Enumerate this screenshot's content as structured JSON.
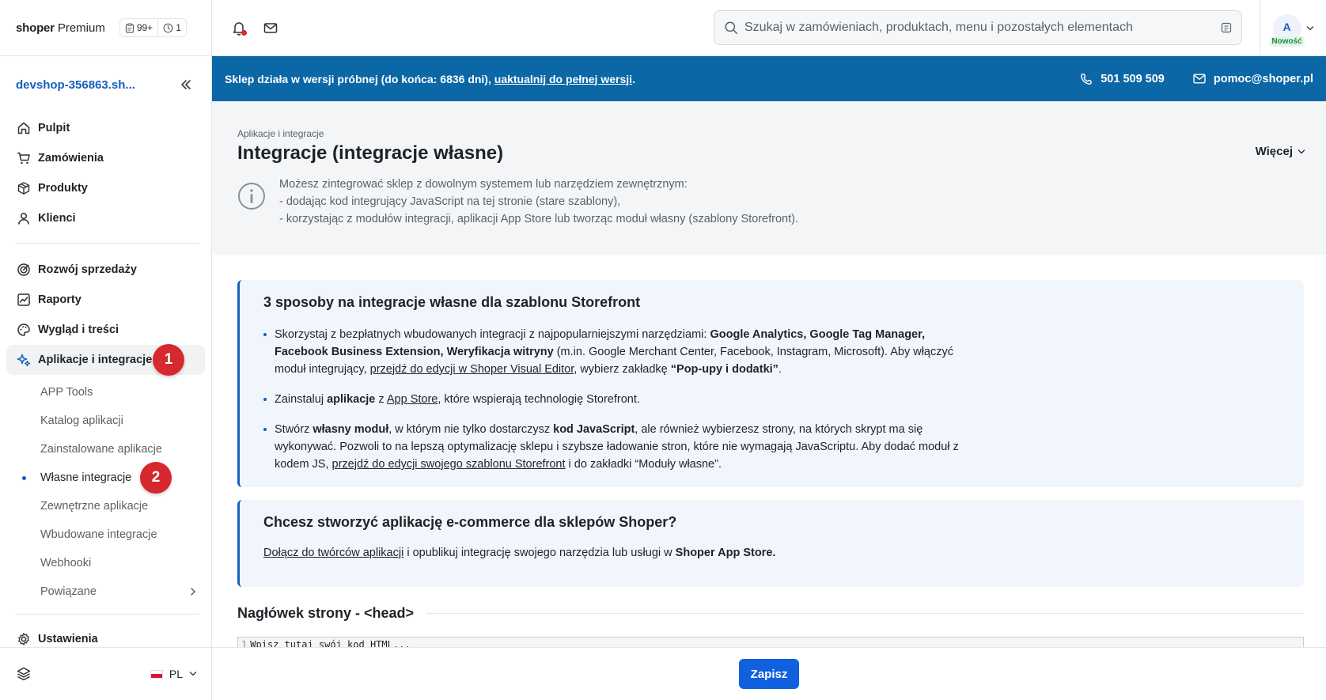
{
  "app": {
    "logo_brand": "shoper",
    "logo_plan": "Premium",
    "counter_tasks": "99+",
    "counter_history": "1"
  },
  "sidebar": {
    "shop_name": "devshop-356863.sh...",
    "main_items": [
      {
        "label": "Pulpit",
        "icon": "home-icon"
      },
      {
        "label": "Zamówienia",
        "icon": "cart-icon"
      },
      {
        "label": "Produkty",
        "icon": "box-icon"
      },
      {
        "label": "Klienci",
        "icon": "user-icon"
      }
    ],
    "secondary_items": [
      {
        "label": "Rozwój sprzedaży",
        "icon": "target-icon"
      },
      {
        "label": "Raporty",
        "icon": "chart-icon"
      },
      {
        "label": "Wygląd i treści",
        "icon": "palette-icon"
      },
      {
        "label": "Aplikacje i integracje",
        "icon": "sparkle-icon",
        "active": true
      }
    ],
    "sub_items": [
      {
        "label": "APP Tools"
      },
      {
        "label": "Katalog aplikacji"
      },
      {
        "label": "Zainstalowane aplikacje"
      },
      {
        "label": "Własne integracje",
        "active": true
      },
      {
        "label": "Zewnętrzne aplikacje"
      },
      {
        "label": "Wbudowane integracje"
      },
      {
        "label": "Webhooki"
      },
      {
        "label": "Powiązane"
      }
    ],
    "settings_label": "Ustawienia",
    "language": "PL",
    "annotation_1": "1",
    "annotation_2": "2"
  },
  "topbar": {
    "search_placeholder": "Szukaj w zamówieniach, produktach, menu i pozostałych elementach",
    "avatar_initial": "A",
    "avatar_badge": "Nowość"
  },
  "banner": {
    "text_prefix": "Sklep działa w wersji próbnej (do końca: 6836 dni), ",
    "upgrade_link": "uaktualnij do pełnej wersji",
    "text_suffix": ".",
    "phone": "501 509 509",
    "email": "pomoc@shoper.pl"
  },
  "header": {
    "breadcrumb": "Aplikacje i integracje",
    "title": "Integracje (integracje własne)",
    "more_label": "Więcej",
    "info_line1": "Możesz zintegrować sklep z dowolnym systemem lub narzędziem zewnętrznym:",
    "info_line2": "- dodając kod integrujący JavaScript na tej stronie (stare szablony),",
    "info_line3": "- korzystając z modułów integracji, aplikacji App Store lub tworząc moduł własny (szablony Storefront)."
  },
  "card1": {
    "title": "3 sposoby na integracje własne dla szablonu Storefront",
    "b1_t1": "Skorzystaj z bezpłatnych wbudowanych integracji z najpopularniejszymi narzędziami: ",
    "b1_bold": "Google Analytics, Google Tag Manager, Facebook Business Extension, Weryfikacja witryny",
    "b1_t2": " (m.in. Google Merchant Center, Facebook, Instagram, Microsoft). Aby włączyć moduł integrujący, ",
    "b1_link": "przejdź do edycji w Shoper Visual Editor",
    "b1_t3": ", wybierz zakładkę ",
    "b1_bold2": "“Pop-upy i dodatki”",
    "b1_t4": ".",
    "b2_t1": "Zainstaluj ",
    "b2_bold": "aplikacje",
    "b2_t2": " z ",
    "b2_link": "App Store",
    "b2_t3": ", które wspierają technologię Storefront.",
    "b3_t1": "Stwórz ",
    "b3_bold": "własny moduł",
    "b3_t2": ", w którym nie tylko dostarczysz ",
    "b3_bold2": "kod JavaScript",
    "b3_t3": ", ale również wybierzesz strony, na których skrypt ma się wykonywać. Pozwoli to na lepszą optymalizację sklepu i szybsze ładowanie stron, które nie wymagają JavaScriptu. Aby dodać moduł z kodem JS, ",
    "b3_link": "przejdź do edycji swojego szablonu Storefront",
    "b3_t4": " i do zakładki “Moduły własne”."
  },
  "card2": {
    "title": "Chcesz stworzyć aplikację e-commerce dla sklepów Shoper?",
    "link": "Dołącz do twórców aplikacji",
    "text": " i opublikuj integrację swojego narzędzia lub usługi w ",
    "bold": "Shoper App Store."
  },
  "head_section": {
    "title": "Nagłówek strony - <head>",
    "line_number": "1",
    "placeholder": "Wpisz tutaj swój kod HTML..."
  },
  "footer": {
    "save_label": "Zapisz"
  },
  "colors": {
    "accent": "#1560bd",
    "banner": "#0b67a6",
    "primary_button": "#1060e0",
    "annotation": "#d7272f"
  }
}
